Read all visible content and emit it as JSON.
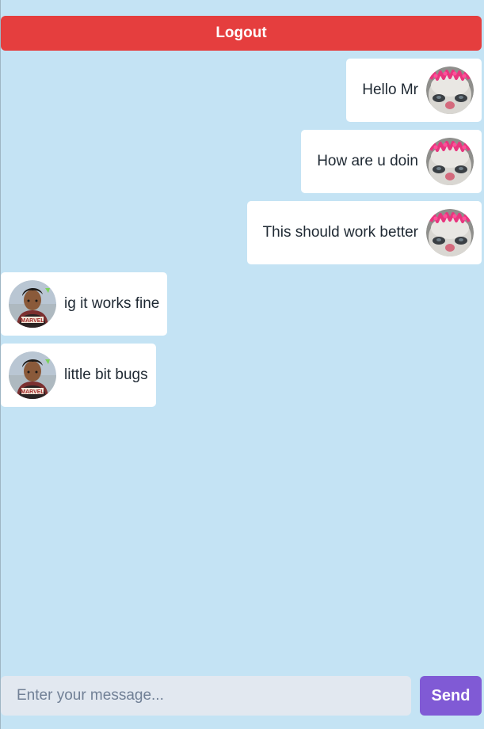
{
  "header": {
    "logout_label": "Logout"
  },
  "messages": [
    {
      "direction": "sent",
      "text": "Hello Mr",
      "avatar": "cat-avatar"
    },
    {
      "direction": "sent",
      "text": "How are u doin",
      "avatar": "cat-avatar"
    },
    {
      "direction": "sent",
      "text": "This should work better",
      "avatar": "cat-avatar"
    },
    {
      "direction": "received",
      "text": "ig it works fine",
      "avatar": "person-avatar"
    },
    {
      "direction": "received",
      "text": "little bit bugs",
      "avatar": "person-avatar"
    }
  ],
  "composer": {
    "input_value": "",
    "placeholder": "Enter your message...",
    "send_label": "Send"
  },
  "colors": {
    "background": "#c4e3f4",
    "logout": "#e53e3e",
    "send": "#805ad5",
    "input": "#e2e8f0",
    "bubble": "#ffffff"
  }
}
